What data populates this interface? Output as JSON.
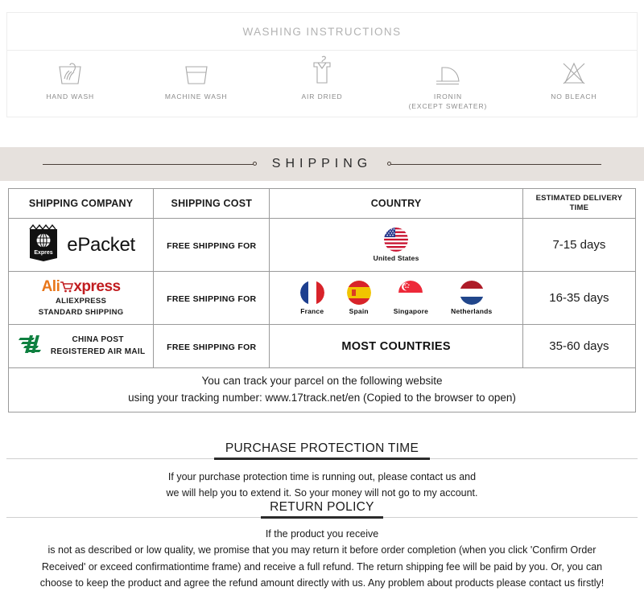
{
  "washing": {
    "title": "WASHING INSTRUCTIONS",
    "items": [
      {
        "icon": "hand-wash-icon",
        "label": "HAND WASH"
      },
      {
        "icon": "machine-wash-icon",
        "label": "MACHINE WASH"
      },
      {
        "icon": "air-dried-icon",
        "label": "AIR DRIED"
      },
      {
        "icon": "iron-icon",
        "label": "IRONIN",
        "label2": "(EXCEPT SWEATER)"
      },
      {
        "icon": "no-bleach-icon",
        "label": "NO BLEACH"
      }
    ]
  },
  "shipping_banner": {
    "title": "SHIPPING"
  },
  "shipping_table": {
    "headers": {
      "company": "SHIPPING COMPANY",
      "cost": "SHIPPING COST",
      "country": "COUNTRY",
      "eta_line1": "ESTIMATED DELIVERY",
      "eta_line2": "TIME"
    },
    "rows": [
      {
        "carrier_logo": "epacket-logo",
        "carrier_name": "ePacket",
        "cost": "FREE SHIPPING FOR",
        "countries": [
          {
            "flag": "flag-us",
            "name": "United States"
          }
        ],
        "eta": "7-15 days"
      },
      {
        "carrier_logo": "aliexpress-logo",
        "carrier_name_part1": "Ali",
        "carrier_name_part2": "xpress",
        "carrier_sub1": "ALIEXPRESS",
        "carrier_sub2": "STANDARD SHIPPING",
        "cost": "FREE SHIPPING FOR",
        "countries": [
          {
            "flag": "flag-fr",
            "name": "France"
          },
          {
            "flag": "flag-es",
            "name": "Spain"
          },
          {
            "flag": "flag-sg",
            "name": "Singapore"
          },
          {
            "flag": "flag-nl",
            "name": "Netherlands"
          }
        ],
        "eta": "16-35 days"
      },
      {
        "carrier_logo": "china-post-logo",
        "carrier_sub1": "CHINA POST",
        "carrier_sub2": "REGISTERED AIR MAIL",
        "cost": "FREE SHIPPING FOR",
        "country_text": "MOST COUNTRIES",
        "eta": "35-60 days"
      }
    ],
    "tracking_line1": "You can track your parcel on the following website",
    "tracking_line2": "using your tracking number: www.17track.net/en (Copied to the browser to open)"
  },
  "purchase_protection": {
    "title": "PURCHASE PROTECTION TIME",
    "line1": "If your purchase protection time is running out, please contact us and",
    "line2": "we will help you to extend it. So your money will not go to my account."
  },
  "return_policy": {
    "title": "RETURN POLICY",
    "line1": "If the product you receive",
    "line2": "is not as described or low quality, we promise that you may return it before order completion (when you click 'Confirm Order",
    "line3": "Received' or exceed confirmationtime frame) and receive a full refund. The return shipping fee will be paid by you. Or, you can",
    "line4": "choose to keep the product and agree the refund amount directly with us. Any problem about products please contact us firstly!"
  },
  "colors": {
    "banner_bg": "#e6e1dd",
    "icon_gray": "#a8a8a8",
    "ali_orange": "#e8761a",
    "ali_red": "#c11d20",
    "china_post_green": "#0f8040"
  }
}
